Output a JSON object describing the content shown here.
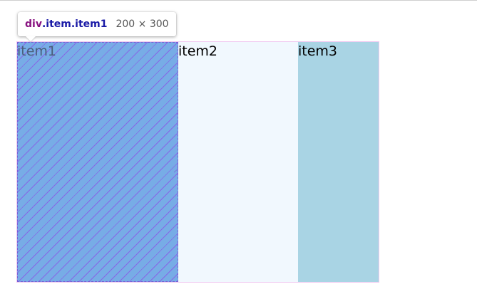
{
  "tooltip": {
    "tag": "div",
    "class_selector": ".item.item1",
    "size": "200 × 300"
  },
  "items": [
    {
      "label": "item1",
      "color": "#77ace6"
    },
    {
      "label": "item2",
      "color": "#f1f8fe"
    },
    {
      "label": "item3",
      "color": "#a9d4e4"
    }
  ],
  "colors": {
    "highlight_hatch": "#8c50e6",
    "tooltip_tag": "#881280",
    "tooltip_class": "#1a1aa6"
  }
}
